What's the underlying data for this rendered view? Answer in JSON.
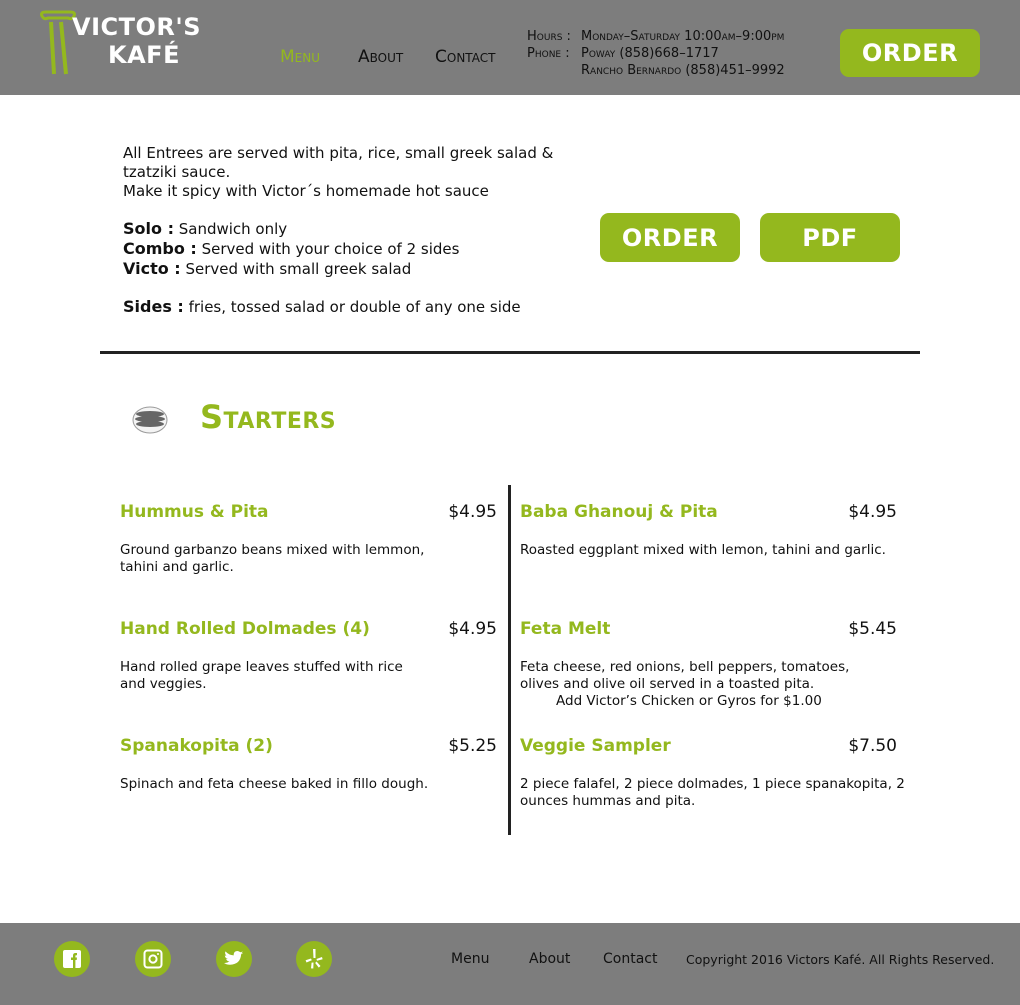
{
  "header": {
    "logo_line1": "VICTOR'S",
    "logo_line2": "KAFÉ",
    "nav": [
      "Menu",
      "About",
      "Contact"
    ],
    "hours_label": "Hours :",
    "hours_value": "Monday–Saturday 10:00am–9:00pm",
    "phone_label": "Phone :",
    "phone_poway": "Poway (858)668–1717",
    "phone_rancho": "Rancho Bernardo (858)451–9992",
    "order_label": "ORDER"
  },
  "intro": {
    "line1": "All Entrees are served with pita, rice, small greek salad & tzatziki sauce.",
    "line2": "Make it spicy with Victor´s homemade hot sauce",
    "solo_label": "Solo :",
    "solo_text": " Sandwich only",
    "combo_label": "Combo :",
    "combo_text": " Served with your choice of 2 sides",
    "victo_label": "Victo :",
    "victo_text": " Served with small greek salad",
    "sides_label": "Sides :",
    "sides_text": " fries, tossed salad or double of any one side"
  },
  "actions": {
    "order_label": "ORDER",
    "pdf_label": "PDF"
  },
  "section": {
    "title": "Starters"
  },
  "menu_left": [
    {
      "name": "Hummus & Pita",
      "price": "$4.95",
      "desc": "Ground garbanzo beans mixed with lemmon, tahini and garlic."
    },
    {
      "name": "Hand Rolled Dolmades (4)",
      "price": "$4.95",
      "desc": "Hand rolled grape leaves stuffed with rice and veggies."
    },
    {
      "name": "Spanakopita (2)",
      "price": "$5.25",
      "desc": "Spinach and feta cheese baked in fillo dough."
    }
  ],
  "menu_right": [
    {
      "name": "Baba Ghanouj & Pita",
      "price": "$4.95",
      "desc": "Roasted eggplant mixed with lemon, tahini and garlic."
    },
    {
      "name": "Feta Melt",
      "price": "$5.45",
      "desc": "Feta cheese, red onions, bell peppers, tomatoes, olives and olive oil served in a toasted pita.",
      "extra": "Add Victor’s Chicken or Gyros for $1.00"
    },
    {
      "name": "Veggie Sampler",
      "price": "$7.50",
      "desc": "2 piece falafel, 2 piece dolmades, 1 piece spanakopita, 2 ounces hummas and pita."
    }
  ],
  "footer": {
    "social": [
      "facebook-icon",
      "instagram-icon",
      "twitter-icon",
      "yelp-icon"
    ],
    "nav": [
      "Menu",
      "About",
      "Contact"
    ],
    "copyright": "Copyright 2016 Victors Kafé. All Rights Reserved."
  },
  "colors": {
    "accent": "#94b81e",
    "header_bg": "#7d7d7d",
    "footer_bg": "#7d7d7d"
  }
}
